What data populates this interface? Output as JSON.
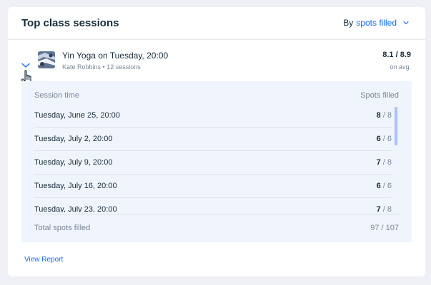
{
  "card": {
    "title": "Top class sessions",
    "sort": {
      "prefix": "By",
      "value": "spots filled"
    }
  },
  "session": {
    "title": "Yin Yoga on Tuesday, 20:00",
    "subtitle": "Kate Robbins • 12 sessions",
    "score": "8.1 / 8.9",
    "score_sub": "on avg.",
    "thumbnail_icon": "class-thumbnail"
  },
  "detail": {
    "col_session_time": "Session time",
    "col_spots_filled": "Spots filled",
    "rows": [
      {
        "date": "Tuesday, June 25, 20:00",
        "filled": "8",
        "capacity": "/ 8"
      },
      {
        "date": "Tuesday, July 2, 20:00",
        "filled": "6",
        "capacity": "/ 6"
      },
      {
        "date": "Tuesday, July 9, 20:00",
        "filled": "7",
        "capacity": "/ 8"
      },
      {
        "date": "Tuesday, July 16, 20:00",
        "filled": "6",
        "capacity": "/ 6"
      },
      {
        "date": "Tuesday, July 23, 20:00",
        "filled": "7",
        "capacity": "/ 8"
      }
    ],
    "total_label": "Total spots filled",
    "total_value": "97 / 107"
  },
  "footer": {
    "view_report": "View Report"
  },
  "colors": {
    "accent": "#116DFF",
    "panel_bg": "#F0F4FD",
    "scrollbar": "#A9C1FF",
    "text_primary": "#162D3D",
    "text_secondary": "#7A8799"
  }
}
